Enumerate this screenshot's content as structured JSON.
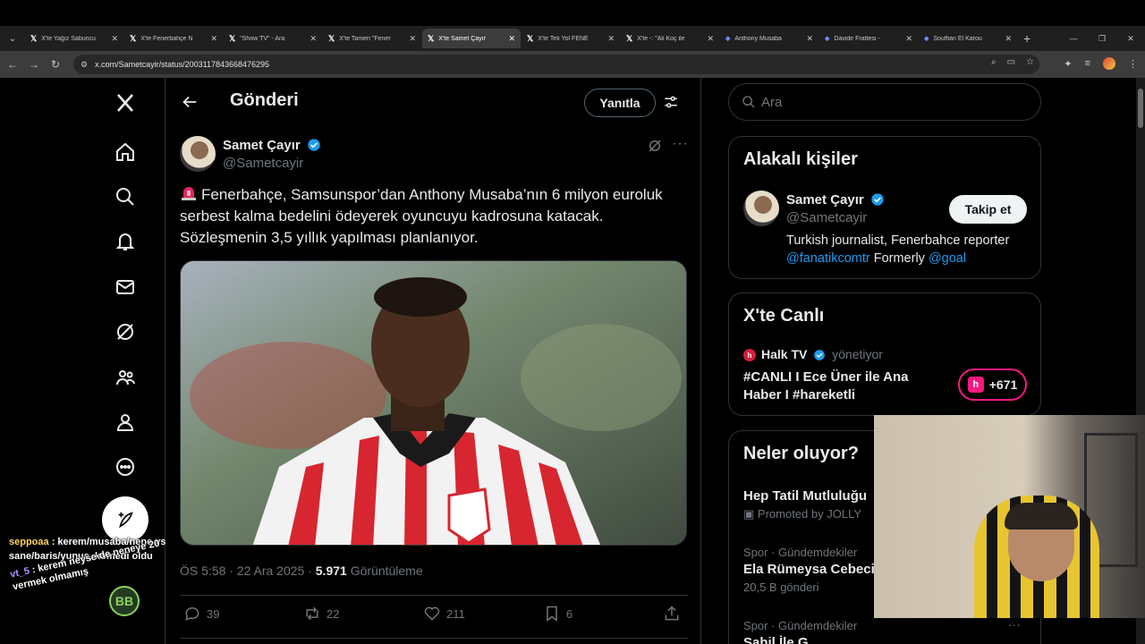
{
  "browser": {
    "tabs": [
      {
        "icon": "x-logo-icon",
        "label": "X'te Yağız Sabuncu"
      },
      {
        "icon": "x-logo-icon",
        "label": "X'te Fenerbahçe N"
      },
      {
        "icon": "x-logo-icon",
        "label": "\"Show TV\" - Ara"
      },
      {
        "icon": "x-logo-icon",
        "label": "X'te Tameri \"Fener"
      },
      {
        "icon": "x-logo-icon",
        "label": "X'te Samet Çayır",
        "active": true
      },
      {
        "icon": "x-logo-icon",
        "label": "X'te Tek Yol FENE"
      },
      {
        "icon": "x-logo-icon",
        "label": "X'te -: \"Ali Koç ile"
      },
      {
        "icon": "site-icon",
        "label": "Anthony Musaba"
      },
      {
        "icon": "site-icon",
        "label": "Davide Frattesi -"
      },
      {
        "icon": "site-icon",
        "label": "Souffian El Karou"
      }
    ],
    "url": "x.com/Sametcayir/status/2003117843668476295"
  },
  "nav": {
    "items": [
      "home-icon",
      "search-icon",
      "notifications-icon",
      "messages-icon",
      "grok-icon",
      "communities-icon",
      "profile-icon",
      "more-icon"
    ]
  },
  "header": {
    "title": "Gönderi",
    "reply_button": "Yanıtla"
  },
  "post": {
    "author_name": "Samet Çayır",
    "author_handle": "@Sametcayir",
    "text": "Fenerbahçe, Samsunspor’dan Anthony Musaba’nın 6 milyon euroluk serbest kalma bedelini ödeyerek oyuncuyu kadrosuna katacak. Sözleşmenin 3,5 yıllık yapılması planlanıyor.",
    "time_date": "ÖS 5:58 · 22 Ara 2025 · ",
    "views_count": "5.971",
    "views_label": " Görüntüleme",
    "replies": "39",
    "reposts": "22",
    "likes": "211",
    "bookmarks": "6"
  },
  "sidebar": {
    "search_placeholder": "Ara",
    "related": {
      "title": "Alakalı kişiler",
      "name": "Samet Çayır",
      "handle": "@Sametcayir",
      "follow_label": "Takip et",
      "bio_text": "Turkish journalist, Fenerbahce reporter",
      "bio_link1": "@fanatikcomtr",
      "bio_mid": " Formerly ",
      "bio_link2": "@goal"
    },
    "live": {
      "title": "X'te Canlı",
      "host": "Halk TV",
      "host_role": "yönetiyor",
      "stream_title": "#CANLI I Ece Üner ile Ana Haber I #hareketli",
      "listeners": "+671"
    },
    "trends": {
      "title": "Neler oluyor?",
      "items": [
        {
          "name": "Hep Tatil Mutluluğu",
          "sub": "Promoted by JOLLY"
        },
        {
          "category": "Spor · Gündemdekiler",
          "name": "Ela Rümeysa Cebeci",
          "sub": "20,5 B gönderi"
        },
        {
          "category": "Spor · Gündemdekiler",
          "name": "Sahil İle G"
        }
      ]
    }
  },
  "overlay": {
    "chat_user1": "seppoaa",
    "chat_msg1": " : kerem/musaba/nene vs sane/baris/yunus, komedi oldu",
    "chat_user2": "vt_5",
    "chat_msg2": " : kerem neyse de neneye 20 vermek olmamış",
    "badge": "BB"
  },
  "colors": {
    "accent": "#1d9bf0",
    "live": "#f91880"
  }
}
